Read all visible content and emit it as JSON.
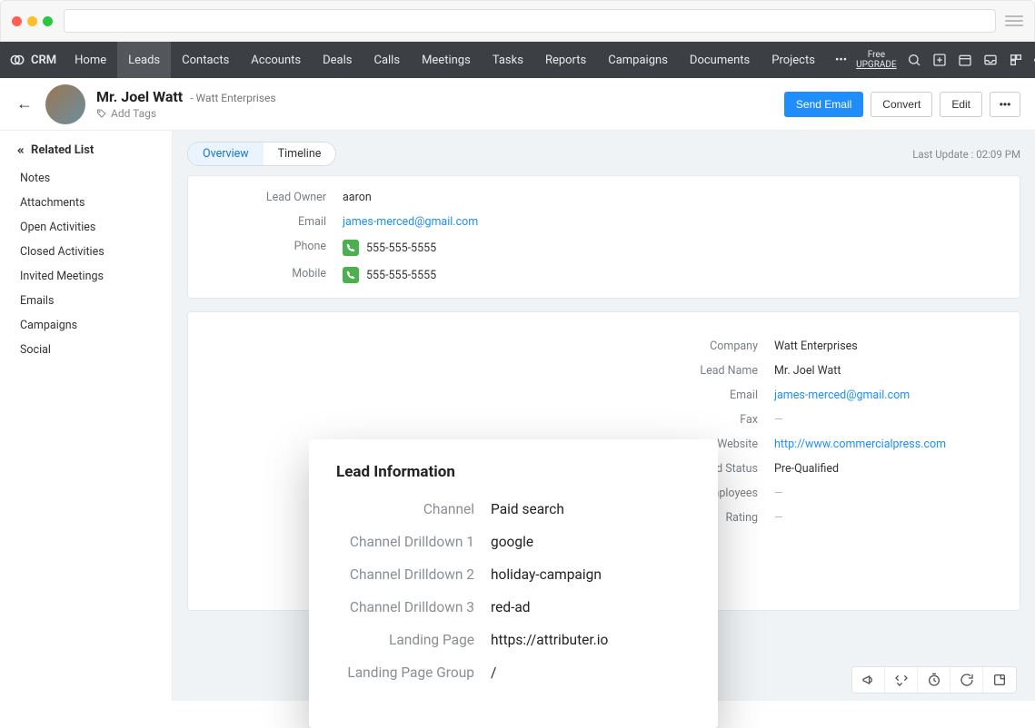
{
  "brand": "CRM",
  "upgrade": {
    "line1": "Free",
    "line2": "UPGRADE"
  },
  "nav": {
    "items": [
      "Home",
      "Leads",
      "Contacts",
      "Accounts",
      "Deals",
      "Calls",
      "Meetings",
      "Tasks",
      "Reports",
      "Campaigns",
      "Documents",
      "Projects"
    ],
    "active": 1
  },
  "lead_header": {
    "name": "Mr. Joel Watt",
    "company": "Watt Enterprises",
    "add_tags": "Add Tags",
    "actions": {
      "send_email": "Send Email",
      "convert": "Convert",
      "edit": "Edit"
    }
  },
  "sidebar": {
    "heading": "Related List",
    "items": [
      "Notes",
      "Attachments",
      "Open Activities",
      "Closed Activities",
      "Invited Meetings",
      "Emails",
      "Campaigns",
      "Social"
    ]
  },
  "tabs": {
    "overview": "Overview",
    "timeline": "Timeline"
  },
  "last_update": "Last Update : 02:09 PM",
  "overview_fields": {
    "lead_owner_label": "Lead Owner",
    "lead_owner": "aaron",
    "email_label": "Email",
    "email": "james-merced@gmail.com",
    "phone_label": "Phone",
    "phone": "555-555-5555",
    "mobile_label": "Mobile",
    "mobile": "555-555-5555"
  },
  "detail_right": {
    "company_label": "Company",
    "company": "Watt Enterprises",
    "lead_name_label": "Lead Name",
    "lead_name": "Mr. Joel Watt",
    "email_label": "Email",
    "email": "james-merced@gmail.com",
    "fax_label": "Fax",
    "fax": "—",
    "website_label": "Website",
    "website": "http://www.commercialpress.com",
    "lead_status_label": "Lead Status",
    "lead_status": "Pre-Qualified",
    "employees_label": "No. of Employees",
    "employees": "—",
    "rating_label": "Rating",
    "rating": "—"
  },
  "popover": {
    "title": "Lead Information",
    "rows": [
      {
        "label": "Channel",
        "value": "Paid search"
      },
      {
        "label": "Channel Drilldown 1",
        "value": "google"
      },
      {
        "label": "Channel Drilldown 2",
        "value": "holiday-campaign"
      },
      {
        "label": "Channel Drilldown 3",
        "value": "red-ad"
      },
      {
        "label": "Landing Page",
        "value": "https://attributer.io"
      },
      {
        "label": "Landing Page Group",
        "value": "/"
      }
    ]
  }
}
